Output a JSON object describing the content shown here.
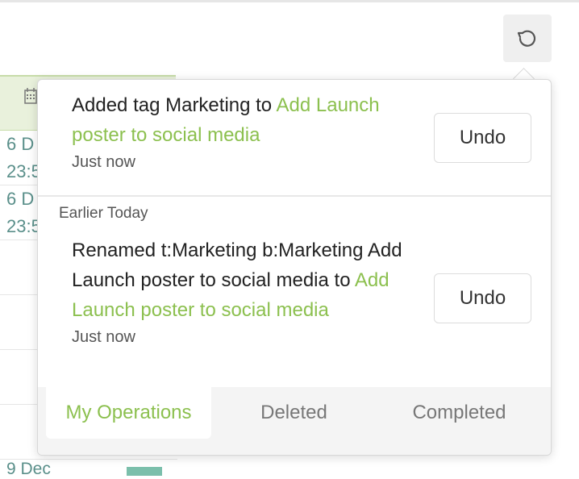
{
  "background": {
    "dates": [
      {
        "line1": "6 D",
        "line2": "23:5"
      },
      {
        "line1": "6 D",
        "line2": "23:5"
      }
    ],
    "bottom_date": "9 Dec"
  },
  "toolbar": {
    "history_icon": "history-undo-icon"
  },
  "operations": {
    "recent": {
      "prefix": "Added tag Marketing to ",
      "link": "Add Launch poster to social media",
      "time": "Just now",
      "undo_label": "Undo"
    },
    "section_label": "Earlier Today",
    "earlier": {
      "prefix": "Renamed t:Marketing b:Marketing Add Launch poster to social media to ",
      "link": "Add Launch poster to social media",
      "time": "Just now",
      "undo_label": "Undo"
    }
  },
  "tabs": [
    {
      "label": "My Operations",
      "active": true
    },
    {
      "label": "Deleted",
      "active": false
    },
    {
      "label": "Completed",
      "active": false
    }
  ],
  "colors": {
    "accent": "#8cc04f",
    "date_text": "#5a8f8a"
  }
}
